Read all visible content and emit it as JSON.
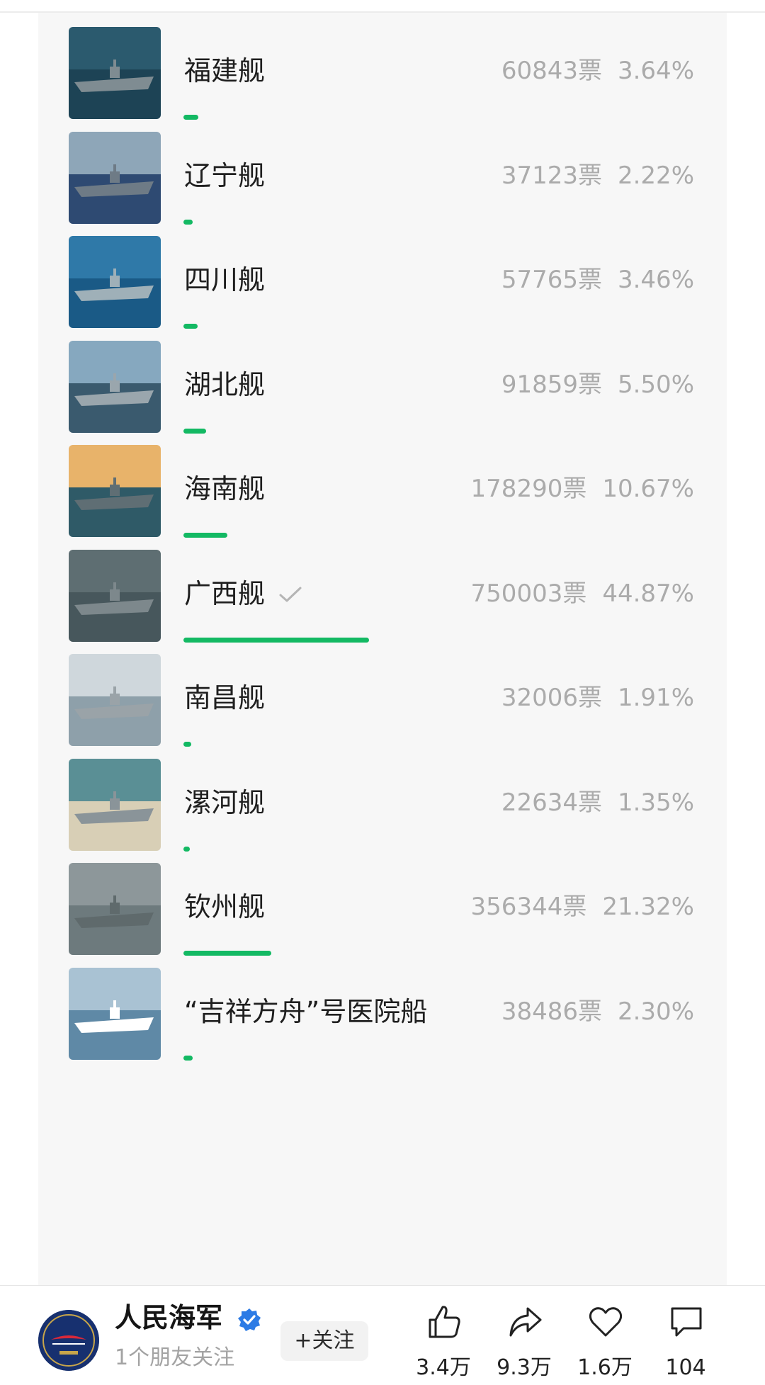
{
  "poll": {
    "items": [
      {
        "name": "福建舰",
        "votes": "60843票",
        "percent": "3.64%",
        "share": 0.0364,
        "selected": false
      },
      {
        "name": "辽宁舰",
        "votes": "37123票",
        "percent": "2.22%",
        "share": 0.0222,
        "selected": false
      },
      {
        "name": "四川舰",
        "votes": "57765票",
        "percent": "3.46%",
        "share": 0.0346,
        "selected": false
      },
      {
        "name": "湖北舰",
        "votes": "91859票",
        "percent": "5.50%",
        "share": 0.055,
        "selected": false
      },
      {
        "name": "海南舰",
        "votes": "178290票",
        "percent": "10.67%",
        "share": 0.1067,
        "selected": false
      },
      {
        "name": "广西舰",
        "votes": "750003票",
        "percent": "44.87%",
        "share": 0.4487,
        "selected": true
      },
      {
        "name": "南昌舰",
        "votes": "32006票",
        "percent": "1.91%",
        "share": 0.0191,
        "selected": false
      },
      {
        "name": "漯河舰",
        "votes": "22634票",
        "percent": "1.35%",
        "share": 0.0135,
        "selected": false
      },
      {
        "name": "钦州舰",
        "votes": "356344票",
        "percent": "21.32%",
        "share": 0.2132,
        "selected": false
      },
      {
        "name": "“吉祥方舟”号医院船",
        "votes": "38486票",
        "percent": "2.30%",
        "share": 0.023,
        "selected": false
      }
    ],
    "bar_color": "#13b963",
    "selected_icon": "checkmark-icon"
  },
  "account": {
    "name": "人民海军",
    "verified_icon": "verified-badge-icon",
    "friends_text": "1个朋友关注",
    "follow_label": "+关注"
  },
  "actions": {
    "like": {
      "icon": "thumbs-up-icon",
      "count": "3.4万"
    },
    "share": {
      "icon": "share-arrow-icon",
      "count": "9.3万"
    },
    "favorite": {
      "icon": "heart-icon",
      "count": "1.6万"
    },
    "comment": {
      "icon": "comment-bubble-icon",
      "count": "104"
    }
  }
}
